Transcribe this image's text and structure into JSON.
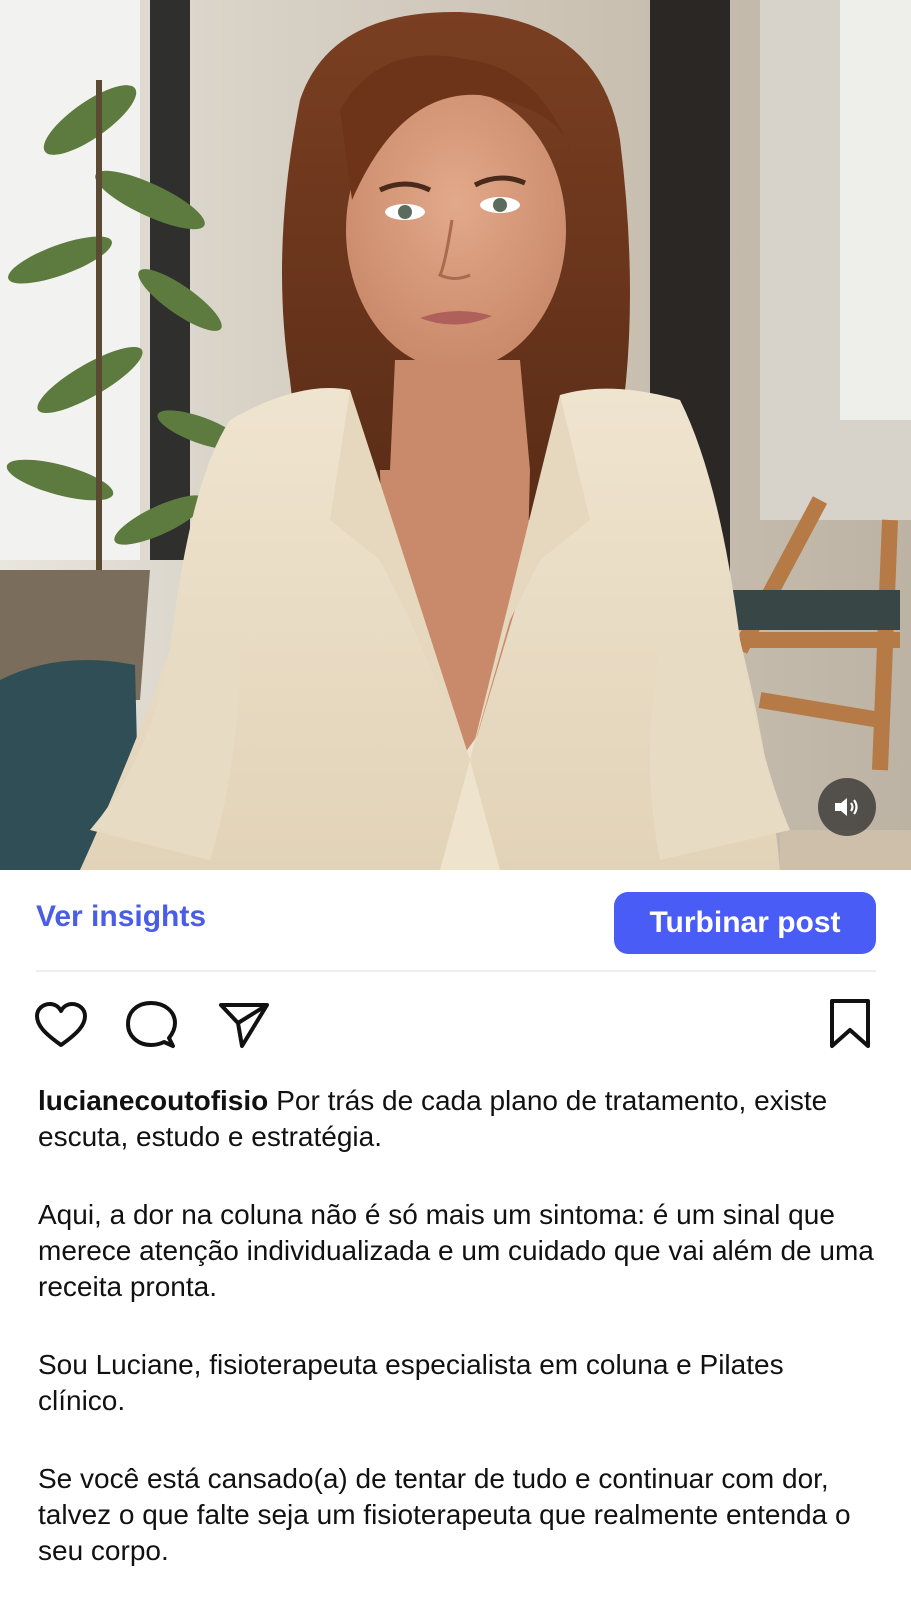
{
  "post": {
    "insights_label": "Ver insights",
    "boost_label": "Turbinar post",
    "username": "lucianecoutofisio",
    "caption_first": "Por trás de cada plano de tratamento, existe escuta, estudo e estratégia.",
    "paragraphs": [
      "Aqui, a dor na coluna não é só mais um sintoma: é um sinal que merece atenção individualizada e um cuidado que vai além de uma receita pronta.",
      "Sou Luciane, fisioterapeuta especialista em coluna e Pilates clínico.",
      "Se você está cansado(a) de tentar de tudo e continuar com dor, talvez o que falte seja um fisioterapeuta que realmente entenda o seu corpo."
    ]
  },
  "icons": {
    "like": "heart-icon",
    "comment": "comment-icon",
    "share": "paper-plane-icon",
    "save": "bookmark-icon",
    "sound": "speaker-icon"
  },
  "colors": {
    "accent": "#4a5cf6",
    "link": "#4a5de6",
    "sound_button_bg": "#282828"
  }
}
